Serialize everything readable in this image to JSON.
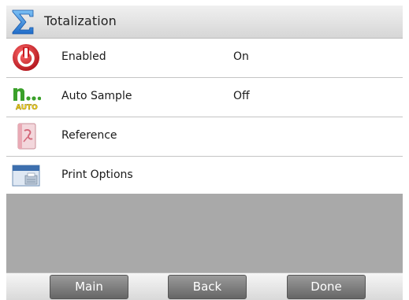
{
  "header": {
    "title": "Totalization",
    "icon": "sigma-icon"
  },
  "menu": [
    {
      "label": "Enabled",
      "value": "On",
      "icon": "power-icon"
    },
    {
      "label": "Auto Sample",
      "value": "Off",
      "icon": "auto-sample-icon",
      "icon_text": "AUTO"
    },
    {
      "label": "Reference",
      "value": "",
      "icon": "reference-book-icon"
    },
    {
      "label": "Print Options",
      "value": "",
      "icon": "printer-icon"
    }
  ],
  "footer": {
    "main_label": "Main",
    "back_label": "Back",
    "done_label": "Done"
  },
  "colors": {
    "power_red": "#d8222a",
    "auto_green": "#3aa02a",
    "auto_yellow": "#f2d21a",
    "sigma_blue": "#2f7fd8",
    "filler_gray": "#a9a9a9",
    "softkey_gray": "#7f7f7f"
  }
}
